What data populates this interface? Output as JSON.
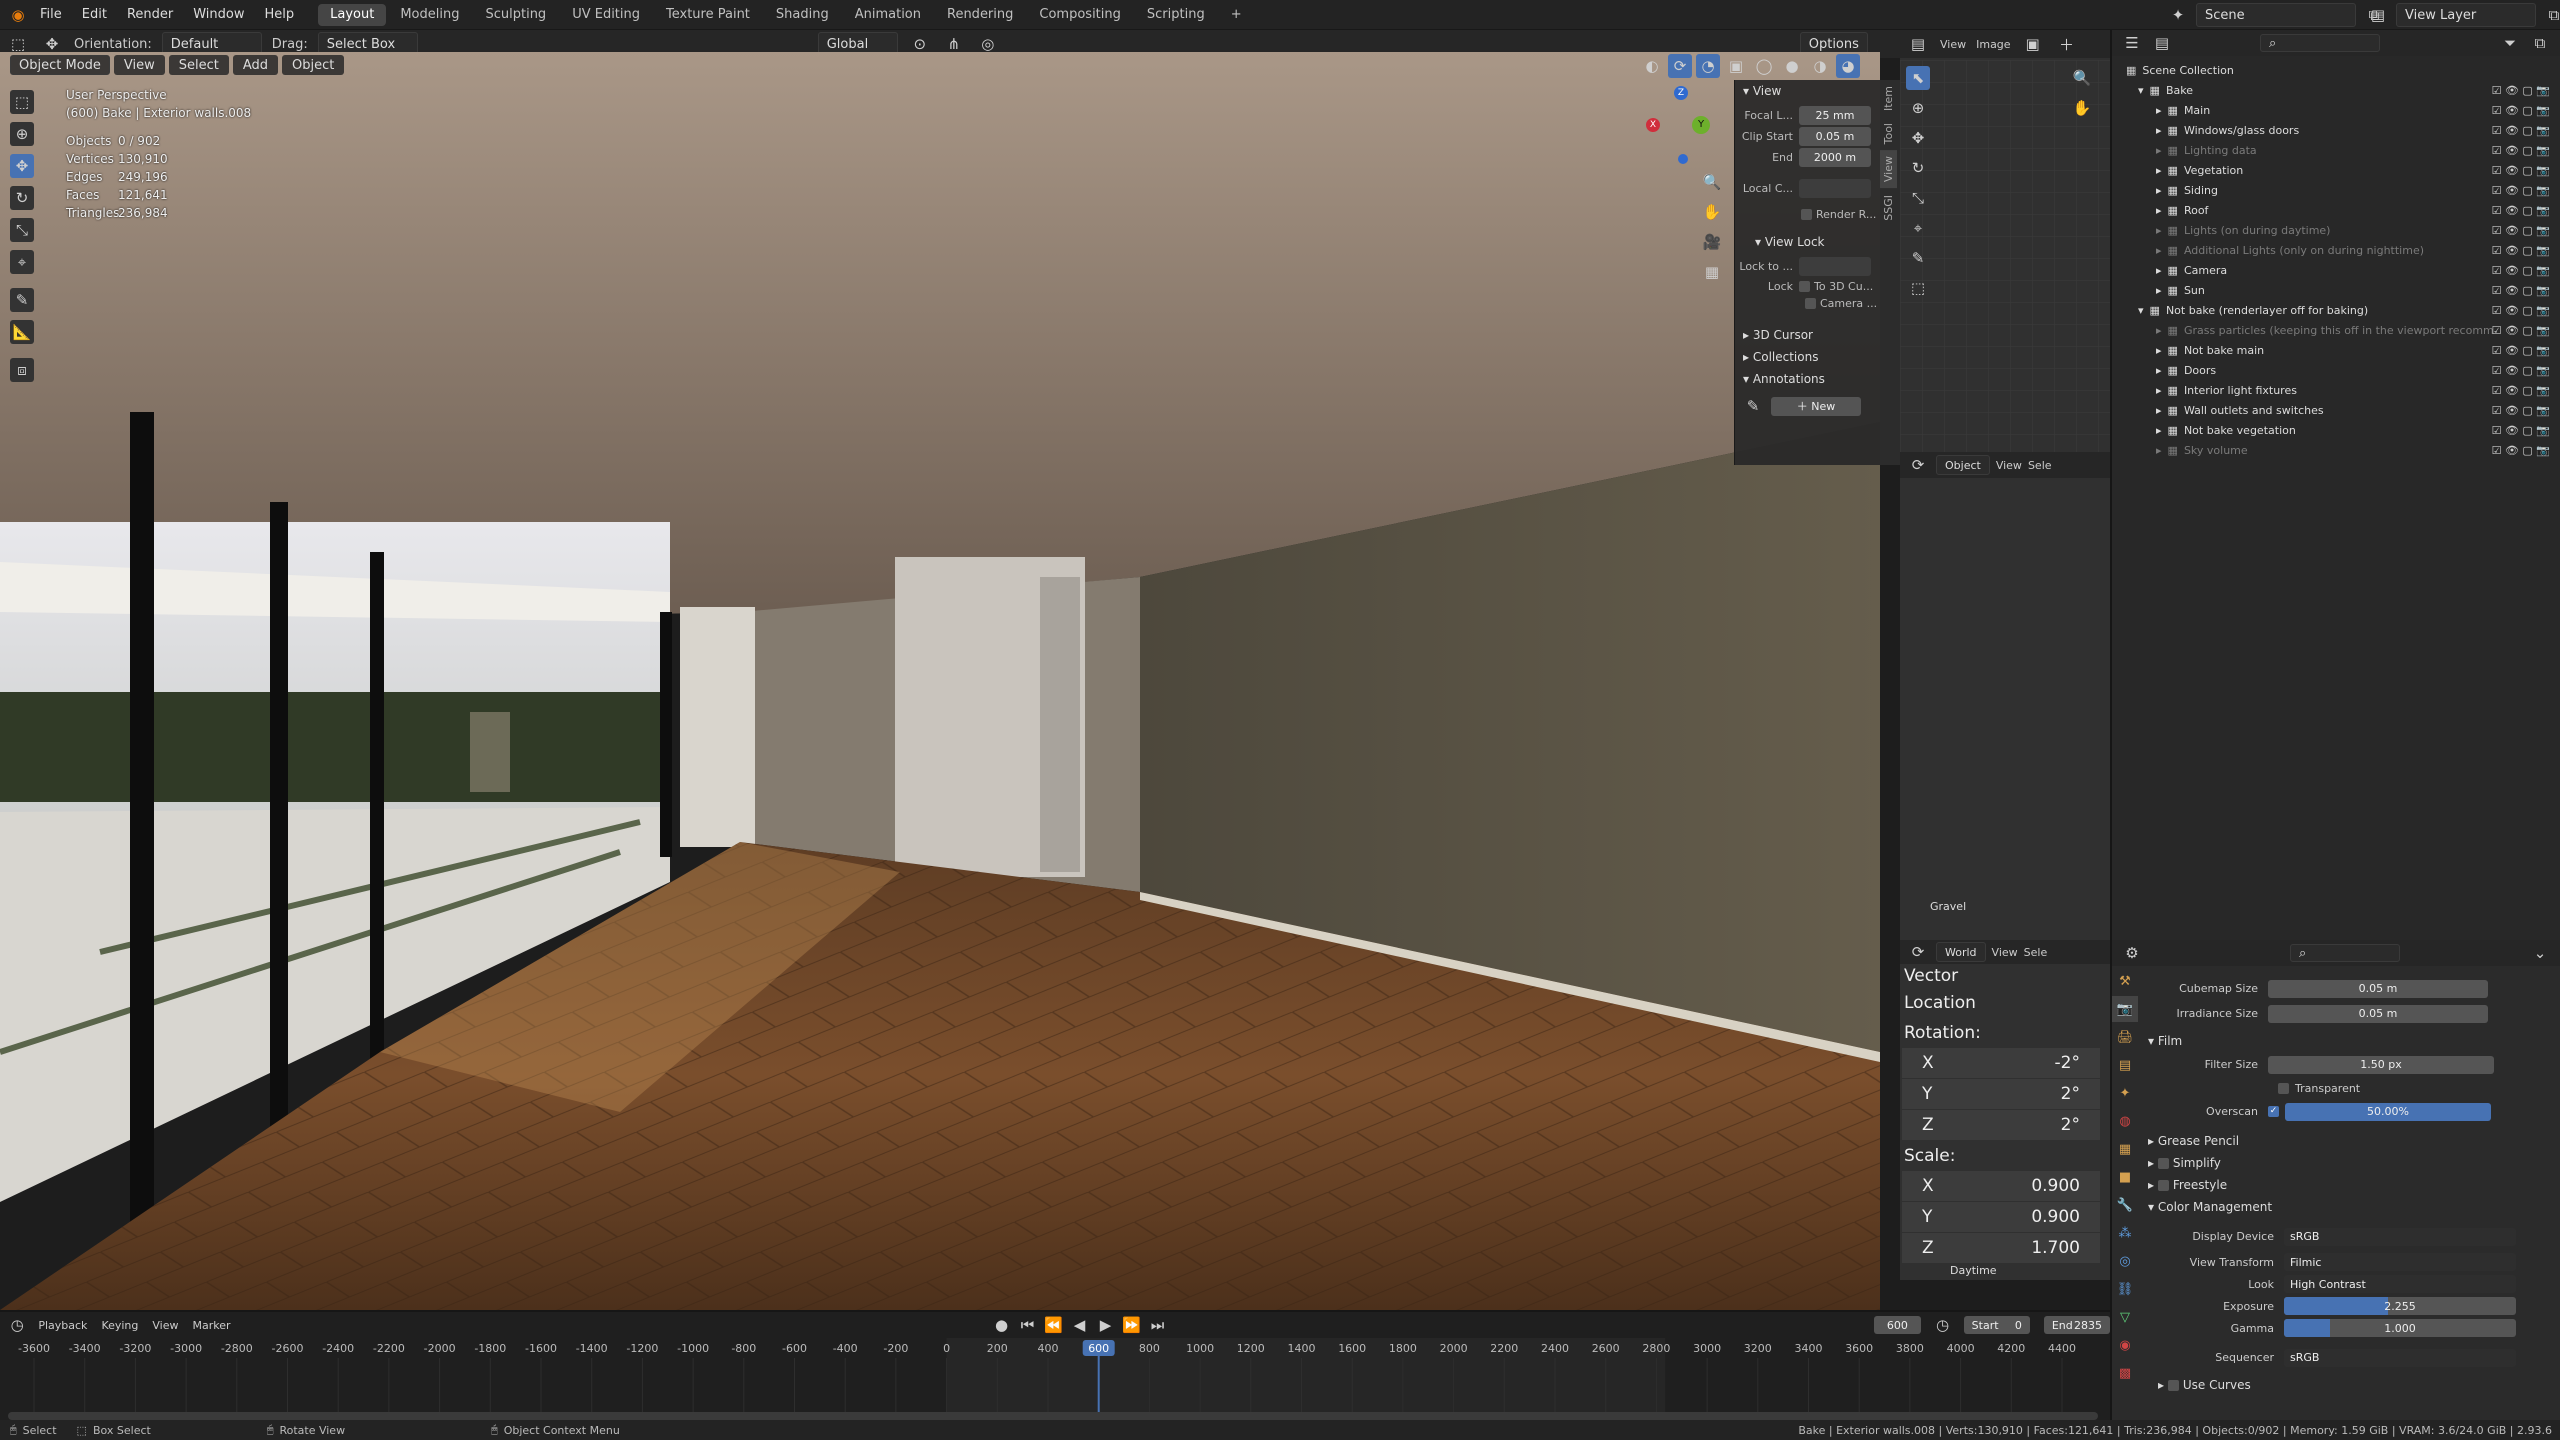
{
  "topbar": {
    "menus": [
      "File",
      "Edit",
      "Render",
      "Window",
      "Help"
    ],
    "workspaces": [
      "Layout",
      "Modeling",
      "Sculpting",
      "UV Editing",
      "Texture Paint",
      "Shading",
      "Animation",
      "Rendering",
      "Compositing",
      "Scripting"
    ],
    "active_workspace": "Layout",
    "add_tab": "+",
    "scene_name": "Scene",
    "view_layer": "View Layer"
  },
  "header3d": {
    "orientation_label": "Orientation:",
    "orientation_value": "Default",
    "drag_label": "Drag:",
    "drag_value": "Select Box",
    "transform_orientation": "Global",
    "options": "Options"
  },
  "viewport_menu": {
    "mode": "Object Mode",
    "items": [
      "View",
      "Select",
      "Add",
      "Object"
    ]
  },
  "viewport": {
    "perspective": "User Perspective",
    "context": "(600) Bake | Exterior walls.008",
    "stats": [
      {
        "label": "Objects",
        "value": "0 / 902"
      },
      {
        "label": "Vertices",
        "value": "130,910"
      },
      {
        "label": "Edges",
        "value": "249,196"
      },
      {
        "label": "Faces",
        "value": "121,641"
      },
      {
        "label": "Triangles",
        "value": "236,984"
      }
    ],
    "gizmo": {
      "x": "X",
      "y": "Y",
      "z": "Z"
    }
  },
  "npanel": {
    "view_header": "View",
    "focal_label": "Focal L...",
    "focal_value": "25 mm",
    "clip_start_label": "Clip Start",
    "clip_start_value": "0.05 m",
    "end_label": "End",
    "end_value": "2000 m",
    "local_camera_label": "Local C...",
    "render_region": "Render R...",
    "view_lock_header": "View Lock",
    "lock_to_label": "Lock to ...",
    "lock_label": "Lock",
    "to_3d_cursor": "To 3D Cu...",
    "camera": "Camera ...",
    "cursor_header": "3D Cursor",
    "collections_header": "Collections",
    "annotations_header": "Annotations",
    "new_button": "New",
    "tabs": [
      "Item",
      "Tool",
      "View",
      "SSGI"
    ]
  },
  "uv_editor": {
    "menu": [
      "View",
      "Image"
    ],
    "object_label": "Object",
    "view2": "View",
    "sel2": "Sele",
    "image_name": "Gravel"
  },
  "node_editor": {
    "world": "World",
    "view": "View",
    "sel": "Sele",
    "title": "Vector",
    "location": "Location",
    "rotation": "Rotation:",
    "rot": [
      {
        "axis": "X",
        "value": "-2°"
      },
      {
        "axis": "Y",
        "value": "2°"
      },
      {
        "axis": "Z",
        "value": "2°"
      }
    ],
    "scale": "Scale:",
    "scl": [
      {
        "axis": "X",
        "value": "0.900"
      },
      {
        "axis": "Y",
        "value": "0.900"
      },
      {
        "axis": "Z",
        "value": "1.700"
      }
    ],
    "footer": "Daytime"
  },
  "outliner": {
    "root": "Scene Collection",
    "items": [
      {
        "label": "Bake",
        "level": 1,
        "dim": false
      },
      {
        "label": "Main",
        "level": 2,
        "dim": false
      },
      {
        "label": "Windows/glass doors",
        "level": 2,
        "dim": false
      },
      {
        "label": "Lighting data",
        "level": 2,
        "dim": true
      },
      {
        "label": "Vegetation",
        "level": 2,
        "dim": false
      },
      {
        "label": "Siding",
        "level": 2,
        "dim": false
      },
      {
        "label": "Roof",
        "level": 2,
        "dim": false
      },
      {
        "label": "Lights (on during daytime)",
        "level": 2,
        "dim": true
      },
      {
        "label": "Additional Lights (only on during nighttime)",
        "level": 2,
        "dim": true
      },
      {
        "label": "Camera",
        "level": 2,
        "dim": false
      },
      {
        "label": "Sun",
        "level": 2,
        "dim": false
      },
      {
        "label": "Not bake (renderlayer off for baking)",
        "level": 1,
        "dim": false
      },
      {
        "label": "Grass particles (keeping this off in the viewport recomm",
        "level": 2,
        "dim": true
      },
      {
        "label": "Not bake main",
        "level": 2,
        "dim": false
      },
      {
        "label": "Doors",
        "level": 2,
        "dim": false
      },
      {
        "label": "Interior light fixtures",
        "level": 2,
        "dim": false
      },
      {
        "label": "Wall outlets and switches",
        "level": 2,
        "dim": false
      },
      {
        "label": "Not bake vegetation",
        "level": 2,
        "dim": false
      },
      {
        "label": "Sky volume",
        "level": 2,
        "dim": true
      }
    ]
  },
  "properties": {
    "cubemap_label": "Cubemap Size",
    "cubemap_value": "0.05 m",
    "irradiance_label": "Irradiance Size",
    "irradiance_value": "0.05 m",
    "film_header": "Film",
    "filter_label": "Filter Size",
    "filter_value": "1.50 px",
    "transparent": "Transparent",
    "overscan_label": "Overscan",
    "overscan_value": "50.00%",
    "grease_pencil": "Grease Pencil",
    "simplify": "Simplify",
    "freestyle": "Freestyle",
    "color_mgmt": "Color Management",
    "display_device_label": "Display Device",
    "display_device_value": "sRGB",
    "view_transform_label": "View Transform",
    "view_transform_value": "Filmic",
    "look_label": "Look",
    "look_value": "High Contrast",
    "exposure_label": "Exposure",
    "exposure_value": "2.255",
    "exposure_fraction": 0.45,
    "gamma_label": "Gamma",
    "gamma_value": "1.000",
    "gamma_fraction": 0.2,
    "sequencer_label": "Sequencer",
    "sequencer_value": "sRGB",
    "use_curves": "Use Curves"
  },
  "timeline": {
    "menus": [
      "Playback",
      "Keying",
      "View",
      "Marker"
    ],
    "current_frame": "600",
    "start_label": "Start",
    "start_value": "0",
    "end_label": "End",
    "end_value": "2835",
    "ticks": [
      "-3600",
      "-3400",
      "-3200",
      "-3000",
      "-2800",
      "-2600",
      "-2400",
      "-2200",
      "-2000",
      "-1800",
      "-1600",
      "-1400",
      "-1200",
      "-1000",
      "-800",
      "-600",
      "-400",
      "-200",
      "0",
      "200",
      "400",
      "600",
      "800",
      "1000",
      "1200",
      "1400",
      "1600",
      "1800",
      "2000",
      "2200",
      "2400",
      "2600",
      "2800",
      "3000",
      "3200",
      "3400",
      "3600",
      "3800",
      "4000",
      "4200",
      "4400"
    ]
  },
  "status": {
    "select": "Select",
    "box_select": "Box Select",
    "rotate_view": "Rotate View",
    "context_menu": "Object Context Menu",
    "info": "Bake | Exterior walls.008 | Verts:130,910 | Faces:121,641 | Tris:236,984 | Objects:0/902 | Memory: 1.59 GiB | VRAM: 3.6/24.0 GiB | 2.93.6"
  }
}
